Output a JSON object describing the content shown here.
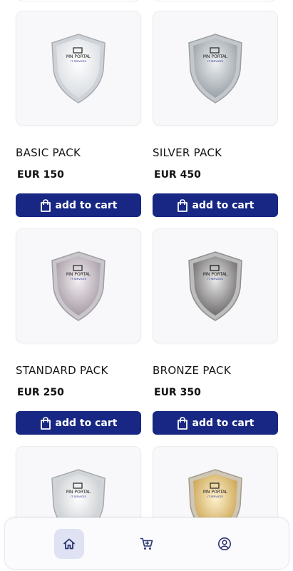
{
  "products": [
    {
      "name": "BASIC PACK",
      "price": "EUR 150",
      "button": "add to cart",
      "logo_line1": "MN PORTAL",
      "logo_line2": "IT SERVICES",
      "shield_color": "#d9dde2"
    },
    {
      "name": "SILVER PACK",
      "price": "EUR 450",
      "button": "add to cart",
      "logo_line1": "MN PORTAL",
      "logo_line2": "IT SERVICES",
      "shield_color": "#9aa2a8"
    },
    {
      "name": "STANDARD PACK",
      "price": "EUR 250",
      "button": "add to cart",
      "logo_line1": "MN PORTAL",
      "logo_line2": "IT SERVICES",
      "shield_color": "#a79ba5"
    },
    {
      "name": "BRONZE PACK",
      "price": "EUR 350",
      "button": "add to cart",
      "logo_line1": "MN PORTAL",
      "logo_line2": "IT SERVICES",
      "shield_color": "#6f6c6c"
    },
    {
      "name": "",
      "price": "",
      "button": "",
      "logo_line1": "MN PORTAL",
      "logo_line2": "IT SERVICES",
      "shield_color": "#c8ccd0"
    },
    {
      "name": "",
      "price": "",
      "button": "",
      "logo_line1": "MN PORTAL",
      "logo_line2": "IT SERVICES",
      "shield_color": "#c9a24e"
    }
  ],
  "nav": {
    "items": [
      {
        "icon": "home-icon",
        "active": true
      },
      {
        "icon": "cart-icon",
        "active": false
      },
      {
        "icon": "account-icon",
        "active": false
      }
    ]
  },
  "colors": {
    "button_bg": "#172783",
    "nav_active_bg": "#dfe2f3",
    "nav_icon": "#2a3470"
  }
}
